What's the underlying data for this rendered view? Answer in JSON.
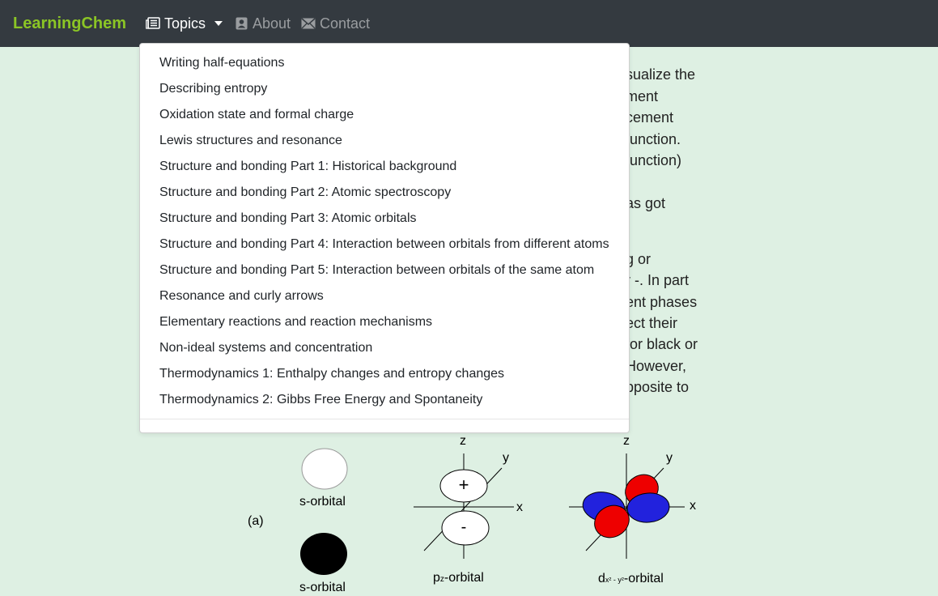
{
  "navbar": {
    "brand": "LearningChem",
    "topics_label": "Topics",
    "about_label": "About",
    "contact_label": "Contact"
  },
  "dropdown": {
    "items": [
      "Writing half-equations",
      "Describing entropy",
      "Oxidation state and formal charge",
      "Lewis structures and resonance",
      "Structure and bonding Part 1: Historical background",
      "Structure and bonding Part 2: Atomic spectroscopy",
      "Structure and bonding Part 3: Atomic orbitals",
      "Structure and bonding Part 4: Interaction between orbitals from different atoms",
      "Structure and bonding Part 5: Interaction between orbitals of the same atom",
      "Resonance and curly arrows",
      "Elementary reactions and reaction mechanisms",
      "Non-ideal systems and concentration",
      "Thermodynamics 1: Enthalpy changes and entropy changes",
      "Thermodynamics 2: Gibbs Free Energy and Spontaneity"
    ]
  },
  "background_text": [
    "sualize the",
    "ment",
    "cement",
    " function.",
    "function)",
    "as got",
    "g or",
    "r -. In part",
    "ent phases",
    "ect their",
    "for black or",
    "However,",
    "pposite to"
  ],
  "figure": {
    "part_label": "(a)",
    "s_label_top": "s-orbital",
    "s_label_bottom": "s-orbital",
    "pz_label": "p",
    "pz_sub": "z",
    "pz_suffix": "-orbital",
    "d_label": "d",
    "d_sub": "x² - y²",
    "d_suffix": "-orbital",
    "axis_z": "z",
    "axis_y": "y",
    "axis_x": "x",
    "plus": "+",
    "minus": "-"
  },
  "colors": {
    "navbar": "#343a40",
    "brand": "#8bc525",
    "background": "#def0e3",
    "lobe_red": "#ee0000",
    "lobe_blue": "#2222dd"
  }
}
